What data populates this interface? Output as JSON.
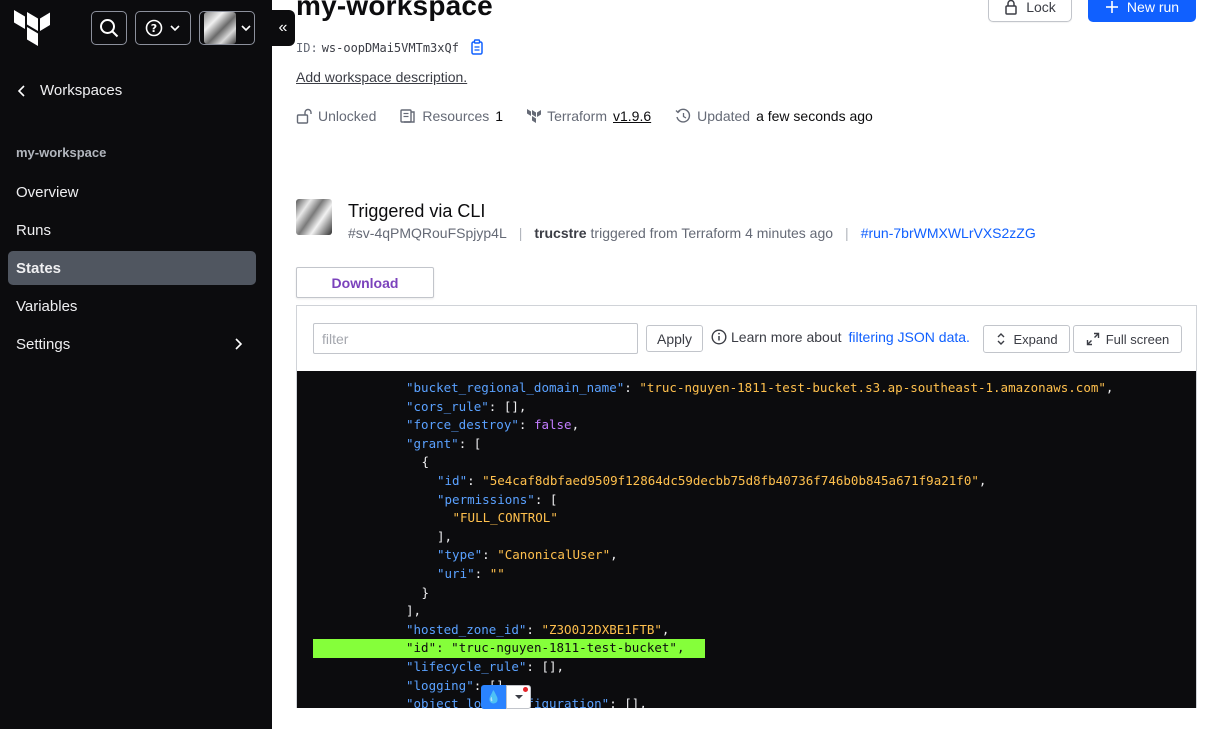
{
  "sidebar": {
    "back_label": "Workspaces",
    "workspace_heading": "my-workspace",
    "nav": [
      {
        "label": "Overview"
      },
      {
        "label": "Runs"
      },
      {
        "label": "States"
      },
      {
        "label": "Variables"
      },
      {
        "label": "Settings"
      }
    ],
    "active_item": "States",
    "collapse_glyph": "«"
  },
  "header": {
    "title": "my-workspace",
    "lock_label": "Lock",
    "new_run_label": "New run",
    "id_label": "ID:",
    "id_value": "ws-oopDMai5VMTm3xQf",
    "add_description": "Add workspace description."
  },
  "meta": {
    "lock_status": "Unlocked",
    "resources_label": "Resources",
    "resources_count": "1",
    "terraform_label": "Terraform",
    "terraform_version": "v1.9.6",
    "updated_label": "Updated",
    "updated_value": "a few seconds ago"
  },
  "run": {
    "title": "Triggered via CLI",
    "state_id": "#sv-4qPMQRouFSpjyp4L",
    "user": "trucstre",
    "triggered_text": "triggered from Terraform 4 minutes ago",
    "run_id": "#run-7brWMXWLrVXS2zZG"
  },
  "state_viewer": {
    "download_label": "Download",
    "filter_placeholder": "filter",
    "apply_label": "Apply",
    "learn_text": "Learn more about",
    "learn_link": "filtering JSON data.",
    "expand_label": "Expand",
    "fullscreen_label": "Full screen"
  },
  "code_lines": [
    {
      "indent": 6,
      "parts": [
        [
          "k",
          "\"bucket_regional_domain_name\""
        ],
        [
          "p",
          ": "
        ],
        [
          "s",
          "\"truc-nguyen-1811-test-bucket.s3.ap-southeast-1.amazonaws.com\""
        ],
        [
          "p",
          ","
        ]
      ]
    },
    {
      "indent": 6,
      "parts": [
        [
          "k",
          "\"cors_rule\""
        ],
        [
          "p",
          ": [],"
        ]
      ]
    },
    {
      "indent": 6,
      "parts": [
        [
          "k",
          "\"force_destroy\""
        ],
        [
          "p",
          ": "
        ],
        [
          "b",
          "false"
        ],
        [
          "p",
          ","
        ]
      ]
    },
    {
      "indent": 6,
      "parts": [
        [
          "k",
          "\"grant\""
        ],
        [
          "p",
          ": ["
        ]
      ]
    },
    {
      "indent": 7,
      "parts": [
        [
          "p",
          "{"
        ]
      ]
    },
    {
      "indent": 8,
      "parts": [
        [
          "k",
          "\"id\""
        ],
        [
          "p",
          ": "
        ],
        [
          "s",
          "\"5e4caf8dbfaed9509f12864dc59decbb75d8fb40736f746b0b845a671f9a21f0\""
        ],
        [
          "p",
          ","
        ]
      ]
    },
    {
      "indent": 8,
      "parts": [
        [
          "k",
          "\"permissions\""
        ],
        [
          "p",
          ": ["
        ]
      ]
    },
    {
      "indent": 9,
      "parts": [
        [
          "s",
          "\"FULL_CONTROL\""
        ]
      ]
    },
    {
      "indent": 8,
      "parts": [
        [
          "p",
          "],"
        ]
      ]
    },
    {
      "indent": 8,
      "parts": [
        [
          "k",
          "\"type\""
        ],
        [
          "p",
          ": "
        ],
        [
          "s",
          "\"CanonicalUser\""
        ],
        [
          "p",
          ","
        ]
      ]
    },
    {
      "indent": 8,
      "parts": [
        [
          "k",
          "\"uri\""
        ],
        [
          "p",
          ": "
        ],
        [
          "s",
          "\"\""
        ]
      ]
    },
    {
      "indent": 7,
      "parts": [
        [
          "p",
          "}"
        ]
      ]
    },
    {
      "indent": 6,
      "parts": [
        [
          "p",
          "],"
        ]
      ]
    },
    {
      "indent": 6,
      "parts": [
        [
          "k",
          "\"hosted_zone_id\""
        ],
        [
          "p",
          ": "
        ],
        [
          "s",
          "\"Z3O0J2DXBE1FTB\""
        ],
        [
          "p",
          ","
        ]
      ]
    },
    {
      "indent": 6,
      "highlight": true,
      "parts": [
        [
          "k",
          "\"id\""
        ],
        [
          "p",
          ": "
        ],
        [
          "s",
          "\"truc-nguyen-1811-test-bucket\""
        ],
        [
          "p",
          ","
        ]
      ]
    },
    {
      "indent": 6,
      "parts": [
        [
          "k",
          "\"lifecycle_rule\""
        ],
        [
          "p",
          ": [],"
        ]
      ]
    },
    {
      "indent": 6,
      "parts": [
        [
          "k",
          "\"logging\""
        ],
        [
          "p",
          ": [],"
        ]
      ]
    },
    {
      "indent": 6,
      "parts": [
        [
          "k",
          "\"object_lo"
        ],
        [
          "p",
          "      "
        ],
        [
          "k",
          "figuration\""
        ],
        [
          "p",
          ": [],"
        ]
      ]
    }
  ],
  "colors": {
    "sidebar_bg": "#0c0c0e",
    "active_nav": "#505660",
    "primary": "#1060ff",
    "download_text": "#7b42bc",
    "json_key": "#5aa1ff",
    "json_string": "#ffc04d",
    "json_bool": "#c37dff",
    "highlight": "#85ff3a"
  },
  "icons": [
    "terraform-logo-icon",
    "search-icon",
    "help-icon",
    "chevron-down-icon",
    "collapse-icon",
    "chevron-left-icon",
    "chevron-right-icon",
    "lock-icon",
    "plus-icon",
    "copy-icon",
    "unlock-icon",
    "resources-icon",
    "terraform-icon",
    "history-icon",
    "info-icon",
    "expand-icon",
    "fullscreen-icon",
    "droplet-icon"
  ]
}
